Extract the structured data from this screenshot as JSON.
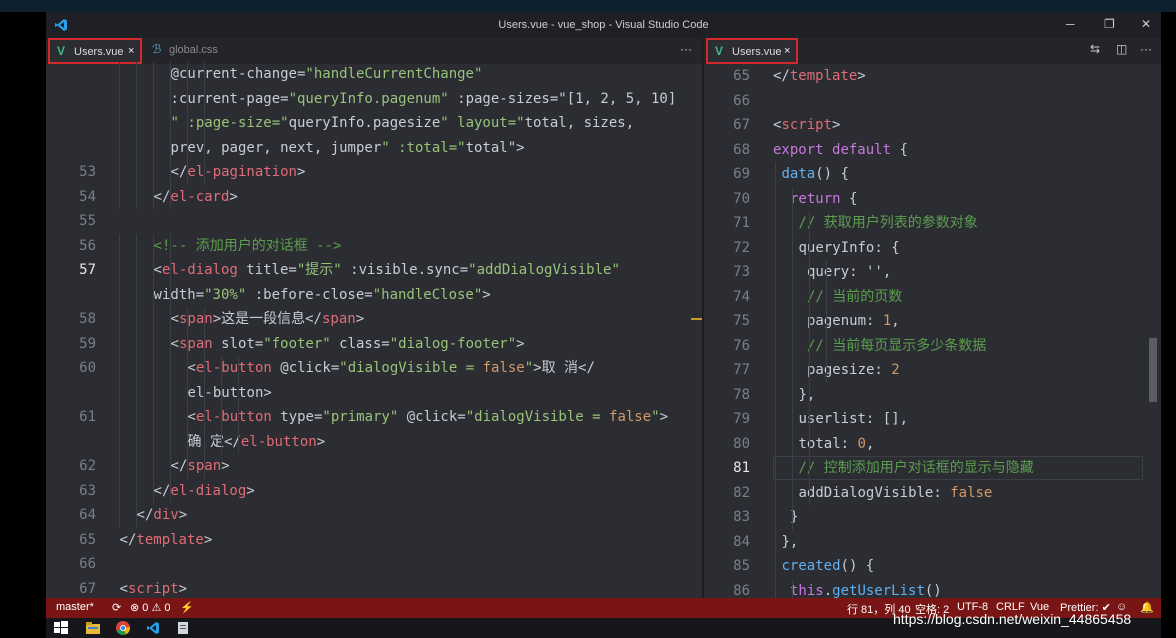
{
  "window": {
    "title": "Users.vue - vue_shop - Visual Studio Code",
    "controls": {
      "minimize": "─",
      "maximize": "❐",
      "close": "✕"
    }
  },
  "left_tabs": [
    {
      "icon": "V",
      "name": "Users.vue",
      "close": "×"
    },
    {
      "icon": "ℬ",
      "name": "global.css"
    }
  ],
  "left_more": "···",
  "right_tabs": [
    {
      "icon": "V",
      "name": "Users.vue",
      "close": "×"
    }
  ],
  "right_actions": {
    "compare": "⇆",
    "split": "◫",
    "more": "···"
  },
  "left_lines": [
    {
      "n": "",
      "t": "@current-change=\"handleCurrentChange\""
    },
    {
      "n": "",
      "t": ":current-page=\"queryInfo.pagenum\" :page-sizes=\"[1, 2, 5, 10]"
    },
    {
      "n": "",
      "t": "\" :page-size=\"queryInfo.pagesize\" layout=\"total, sizes,"
    },
    {
      "n": "",
      "t": "prev, pager, next, jumper\" :total=\"total\">"
    },
    {
      "n": "53",
      "t": "</el-pagination>"
    },
    {
      "n": "54",
      "t": "</el-card>"
    },
    {
      "n": "55",
      "t": ""
    },
    {
      "n": "56",
      "t": "<!-- 添加用户的对话框 -->"
    },
    {
      "n": "57",
      "t": "<el-dialog title=\"提示\" :visible.sync=\"addDialogVisible\""
    },
    {
      "n": "",
      "t": "width=\"30%\" :before-close=\"handleClose\">"
    },
    {
      "n": "58",
      "t": "<span>这是一段信息</span>"
    },
    {
      "n": "59",
      "t": "<span slot=\"footer\" class=\"dialog-footer\">"
    },
    {
      "n": "60",
      "t": "<el-button @click=\"dialogVisible = false\">取 消</"
    },
    {
      "n": "",
      "t": "el-button>"
    },
    {
      "n": "61",
      "t": "<el-button type=\"primary\" @click=\"dialogVisible = false\">"
    },
    {
      "n": "",
      "t": "确 定</el-button>"
    },
    {
      "n": "62",
      "t": "</span>"
    },
    {
      "n": "63",
      "t": "</el-dialog>"
    },
    {
      "n": "64",
      "t": "</div>"
    },
    {
      "n": "65",
      "t": "</template>"
    },
    {
      "n": "66",
      "t": ""
    },
    {
      "n": "67",
      "t": "<script>"
    }
  ],
  "right_lines": [
    {
      "n": "65",
      "t": "</template>"
    },
    {
      "n": "66",
      "t": ""
    },
    {
      "n": "67",
      "t": "<script>"
    },
    {
      "n": "68",
      "t": "export default {"
    },
    {
      "n": "69",
      "t": "data() {"
    },
    {
      "n": "70",
      "t": "return {"
    },
    {
      "n": "71",
      "t": "// 获取用户列表的参数对象"
    },
    {
      "n": "72",
      "t": "queryInfo: {"
    },
    {
      "n": "73",
      "t": "query: '',"
    },
    {
      "n": "74",
      "t": "// 当前的页数"
    },
    {
      "n": "75",
      "t": "pagenum: 1,"
    },
    {
      "n": "76",
      "t": "// 当前每页显示多少条数据"
    },
    {
      "n": "77",
      "t": "pagesize: 2"
    },
    {
      "n": "78",
      "t": "},"
    },
    {
      "n": "79",
      "t": "userlist: [],"
    },
    {
      "n": "80",
      "t": "total: 0,"
    },
    {
      "n": "81",
      "t": "// 控制添加用户对话框的显示与隐藏"
    },
    {
      "n": "82",
      "t": "addDialogVisible: false"
    },
    {
      "n": "83",
      "t": "}"
    },
    {
      "n": "84",
      "t": "},"
    },
    {
      "n": "85",
      "t": "created() {"
    },
    {
      "n": "86",
      "t": "this.getUserList()"
    }
  ],
  "status": {
    "branch": "master*",
    "sync": "⟳",
    "problems": "⊗ 0 ⚠ 0",
    "lightning": "⚡",
    "position": "行 81，列 40",
    "spaces": "空格: 2",
    "encoding": "UTF-8",
    "eol": "CRLF",
    "language": "Vue",
    "prettier": "Prettier: ✔",
    "feedback": "☺",
    "bell": "🔔"
  },
  "watermark": "https://blog.csdn.net/weixin_44865458",
  "colors": {
    "status_bar": "#7a1515",
    "tab_highlight_border": "#d32b2b",
    "vue_icon": "#41b883"
  }
}
